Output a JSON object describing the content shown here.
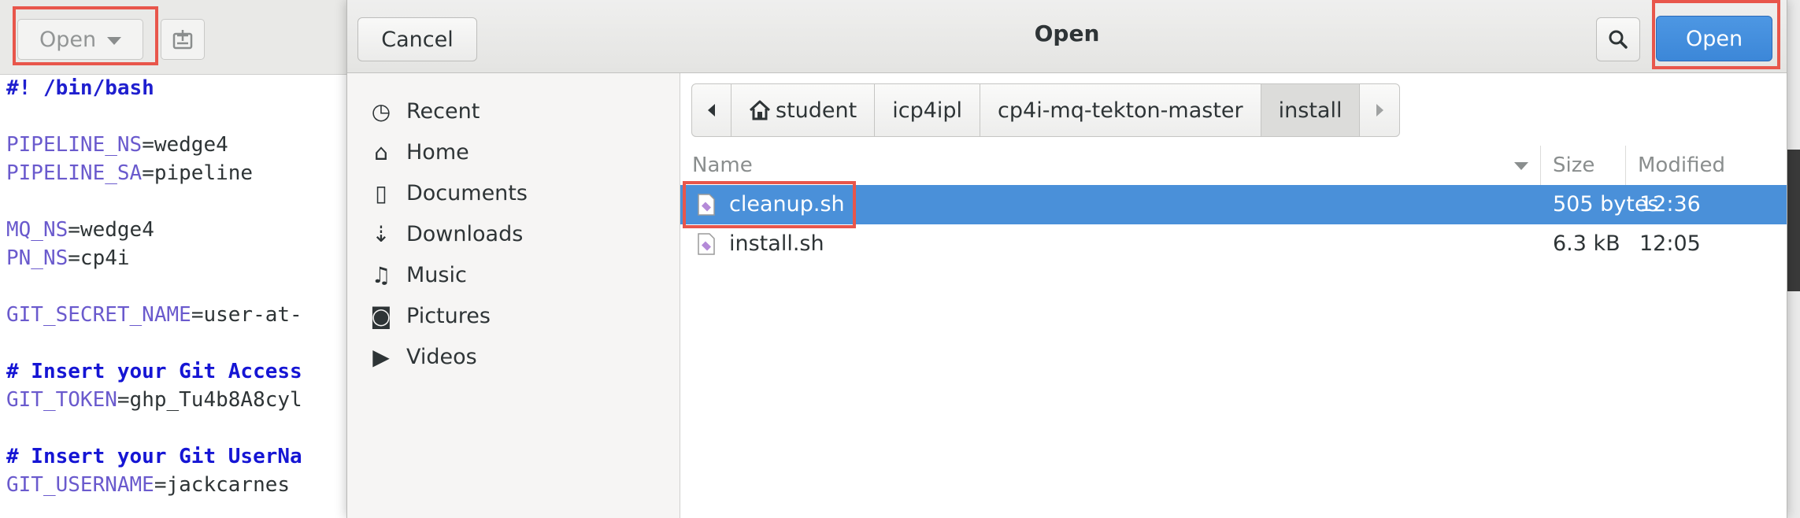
{
  "editor": {
    "open_label": "Open",
    "code_lines": [
      {
        "kind": "shebang",
        "text": "#! /bin/bash"
      },
      {
        "kind": "gap"
      },
      {
        "kind": "assign",
        "var": "PIPELINE_NS",
        "val": "=wedge4"
      },
      {
        "kind": "assign",
        "var": "PIPELINE_SA",
        "val": "=pipeline"
      },
      {
        "kind": "gap"
      },
      {
        "kind": "assign",
        "var": "MQ_NS",
        "val": "=wedge4"
      },
      {
        "kind": "assign",
        "var": "PN_NS",
        "val": "=cp4i"
      },
      {
        "kind": "gap"
      },
      {
        "kind": "assign",
        "var": "GIT_SECRET_NAME",
        "val": "=user-at-"
      },
      {
        "kind": "gap"
      },
      {
        "kind": "comment",
        "text": "# Insert your Git Access"
      },
      {
        "kind": "assign",
        "var": "GIT_TOKEN",
        "val": "=ghp_Tu4b8A8cyl"
      },
      {
        "kind": "gap"
      },
      {
        "kind": "comment",
        "text": "# Insert your Git UserNa"
      },
      {
        "kind": "assign",
        "var": "GIT_USERNAME",
        "val": "=jackcarnes"
      }
    ]
  },
  "dialog": {
    "title": "Open",
    "cancel_label": "Cancel",
    "open_label": "Open",
    "accent_color": "#4a90d9",
    "sidebar": [
      {
        "label": "Recent",
        "icon": "clock-icon",
        "glyph": "◷"
      },
      {
        "label": "Home",
        "icon": "home-icon",
        "glyph": "⌂"
      },
      {
        "label": "Documents",
        "icon": "document-icon",
        "glyph": "▯"
      },
      {
        "label": "Downloads",
        "icon": "download-icon",
        "glyph": "⇣"
      },
      {
        "label": "Music",
        "icon": "music-icon",
        "glyph": "♫"
      },
      {
        "label": "Pictures",
        "icon": "camera-icon",
        "glyph": "◙"
      },
      {
        "label": "Videos",
        "icon": "video-icon",
        "glyph": "▶"
      }
    ],
    "pathbar": [
      "student",
      "icp4ipl",
      "cp4i-mq-tekton-master",
      "install"
    ],
    "columns": {
      "name": "Name",
      "size": "Size",
      "modified": "Modified"
    },
    "files": [
      {
        "name": "cleanup.sh",
        "size": "505 bytes",
        "modified": "12:36",
        "selected": true
      },
      {
        "name": "install.sh",
        "size": "6.3 kB",
        "modified": "12:05",
        "selected": false
      }
    ]
  }
}
